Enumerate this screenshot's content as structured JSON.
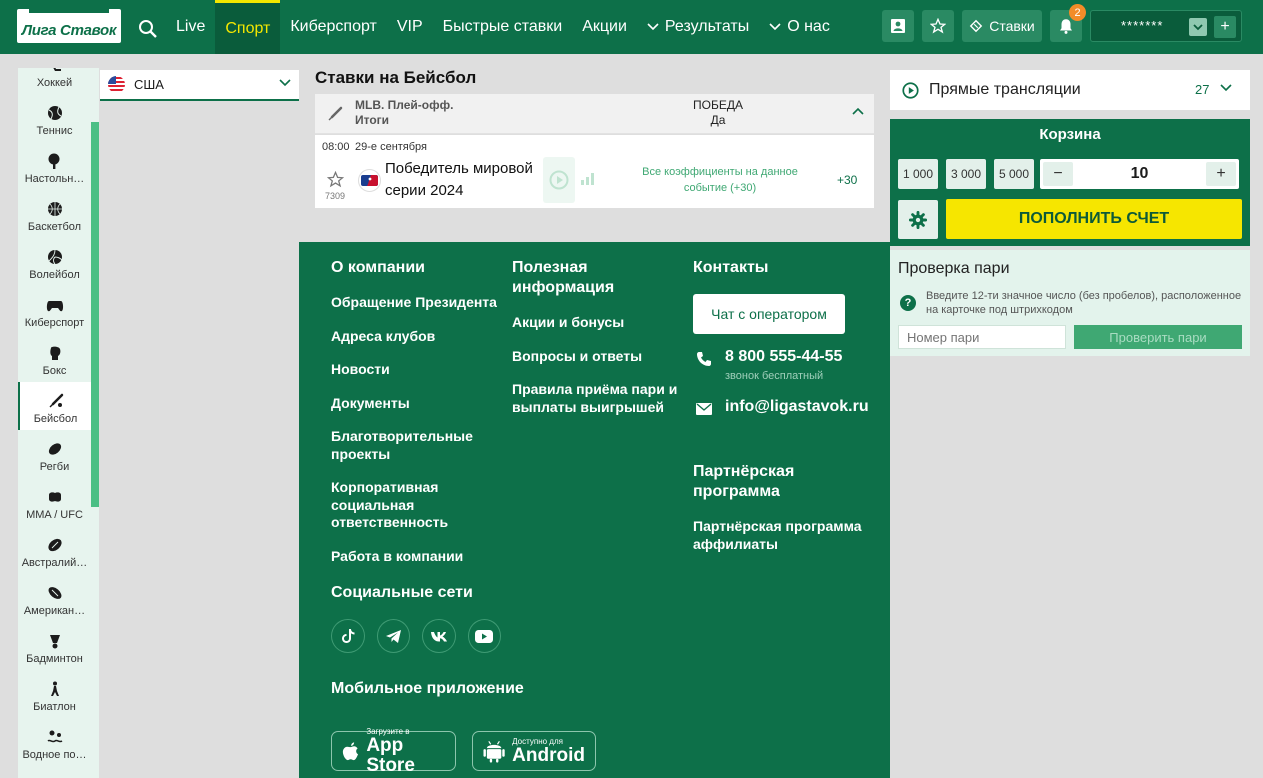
{
  "header": {
    "logo_text": "Лига Ставок",
    "nav": [
      {
        "label": "Live",
        "chevron": false
      },
      {
        "label": "Спорт",
        "chevron": false,
        "active": true
      },
      {
        "label": "Киберспорт",
        "chevron": false
      },
      {
        "label": "VIP",
        "chevron": false
      },
      {
        "label": "Быстрые ставки",
        "chevron": false
      },
      {
        "label": "Акции",
        "chevron": false
      },
      {
        "label": "Результаты",
        "chevron": true
      },
      {
        "label": "О нас",
        "chevron": true
      }
    ],
    "bets_label": "Ставки",
    "notifications_count": "2",
    "account_masked": "*******",
    "plus_label": "+"
  },
  "sports": [
    {
      "label": "Хоккей",
      "icon": "hockey-icon"
    },
    {
      "label": "Теннис",
      "icon": "tennis-icon"
    },
    {
      "label": "Настольн…",
      "icon": "table-tennis-icon"
    },
    {
      "label": "Баскетбол",
      "icon": "basketball-icon"
    },
    {
      "label": "Волейбол",
      "icon": "volleyball-icon"
    },
    {
      "label": "Киберспорт",
      "icon": "gamepad-icon"
    },
    {
      "label": "Бокс",
      "icon": "boxing-icon"
    },
    {
      "label": "Бейсбол",
      "icon": "baseball-icon",
      "active": true
    },
    {
      "label": "Регби",
      "icon": "rugby-icon"
    },
    {
      "label": "MMA / UFC",
      "icon": "mma-icon"
    },
    {
      "label": "Австралий…",
      "icon": "aussie-football-icon"
    },
    {
      "label": "Америкaн…",
      "icon": "american-football-icon"
    },
    {
      "label": "Бадминтон",
      "icon": "badminton-icon"
    },
    {
      "label": "Биатлон",
      "icon": "biathlon-icon"
    },
    {
      "label": "Водное по…",
      "icon": "water-polo-icon"
    }
  ],
  "country": {
    "value": "США"
  },
  "bets": {
    "title": "Ставки на Бейсбол",
    "league_line1": "MLB. Плей-офф.",
    "league_line2": "Итоги",
    "column_title": "ПОБЕДА",
    "column_sub": "Да",
    "event": {
      "time": "08:00",
      "date": "29-е сентября",
      "id": "7309",
      "name": "Победитель мировой серии 2024",
      "all_odds": "Все коэффициенты на данное событие (+30)",
      "more": "+30"
    }
  },
  "footer": {
    "company_title": "О компании",
    "company_links": [
      "Обращение Президента",
      "Адреса клубов",
      "Новости",
      "Документы",
      "Благотворительные проекты",
      "Корпоративная социальная ответственность",
      "Работа в компании"
    ],
    "useful_title": "Полезная информация",
    "useful_links": [
      "Акции и бонусы",
      "Вопросы и ответы",
      "Правила приёма пари и выплаты выигрышей"
    ],
    "contacts_title": "Контакты",
    "chat_label": "Чат с оператором",
    "phone": "8 800 555-44-55",
    "phone_note": "звонок бесплатный",
    "email": "info@ligastavok.ru",
    "partner_title": "Партнёрская программа",
    "partner_link": "Партнёрская программа аффилиаты",
    "social_title": "Социальные сети",
    "mobile_title": "Мобильное приложение",
    "appstore_small": "Загрузите в",
    "appstore_big": "App Store",
    "android_small": "Доступно для",
    "android_big": "Android"
  },
  "right": {
    "live_title": "Прямые трансляции",
    "live_count": "27",
    "cart_title": "Корзина",
    "amounts": [
      "1 000",
      "3 000",
      "5 000"
    ],
    "stake_minus": "−",
    "stake_value": "10",
    "stake_plus": "+",
    "topup_label": "ПОПОЛНИТЬ СЧЕТ",
    "check_title": "Проверка пари",
    "check_desc": "Введите 12-ти значное число (без пробелов), расположенное на карточке под штрихкодом",
    "check_placeholder": "Номер пари",
    "check_button": "Проверить пари"
  },
  "colors": {
    "brand": "#0d7049",
    "accent": "#f6e600",
    "badge": "#f28c28"
  }
}
